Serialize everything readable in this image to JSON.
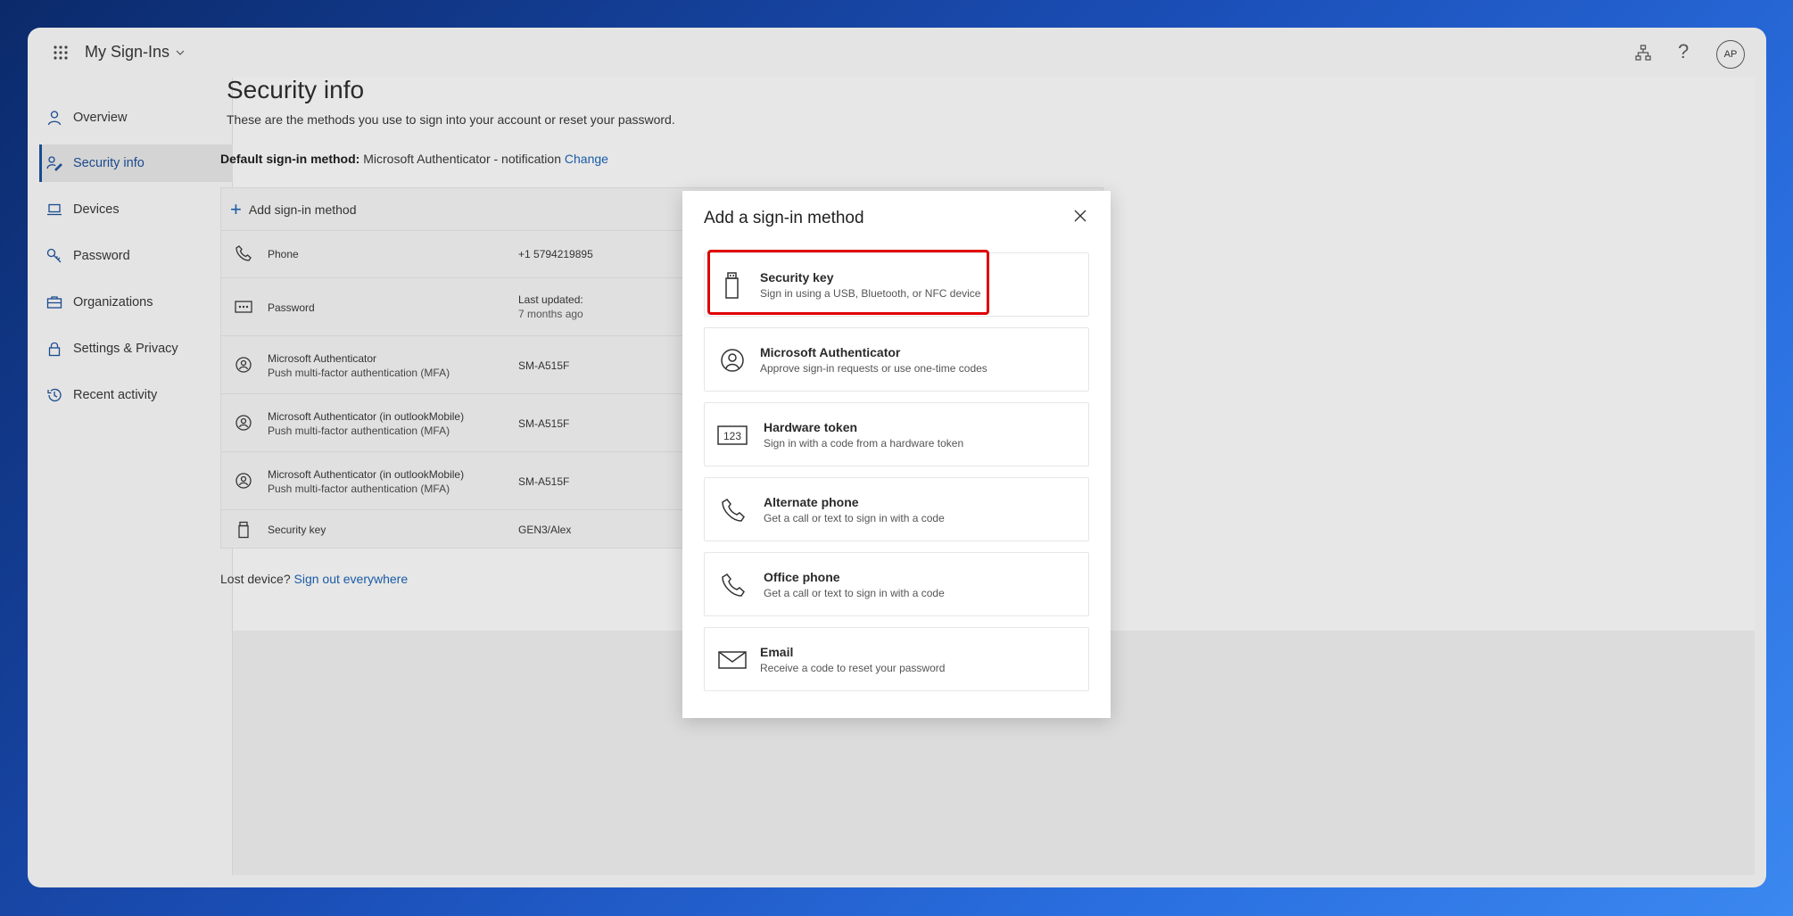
{
  "app": {
    "title": "My Sign-Ins",
    "avatar_initials": "AP"
  },
  "nav": {
    "items": [
      {
        "label": "Overview",
        "icon": "person-icon"
      },
      {
        "label": "Security info",
        "icon": "security-info-icon"
      },
      {
        "label": "Devices",
        "icon": "laptop-icon"
      },
      {
        "label": "Password",
        "icon": "key-icon"
      },
      {
        "label": "Organizations",
        "icon": "briefcase-icon"
      },
      {
        "label": "Settings & Privacy",
        "icon": "lock-icon"
      },
      {
        "label": "Recent activity",
        "icon": "history-icon"
      }
    ],
    "active": "Security info"
  },
  "page": {
    "title": "Security info",
    "subtitle": "These are the methods you use to sign into your account or reset your password.",
    "default_label": "Default sign-in method:",
    "default_value": "Microsoft Authenticator - notification",
    "change_link": "Change",
    "add_method": "Add sign-in method",
    "lost_device_label": "Lost device?",
    "sign_out_everywhere": "Sign out everywhere"
  },
  "methods": [
    {
      "name": "Phone",
      "detail": "",
      "value": "+1 5794219895",
      "value2": "",
      "icon": "phone-icon"
    },
    {
      "name": "Password",
      "detail": "",
      "value": "Last updated:",
      "value2": "7 months ago",
      "icon": "password-icon"
    },
    {
      "name": "Microsoft Authenticator",
      "detail": "Push multi-factor authentication (MFA)",
      "value": "SM-A515F",
      "value2": "",
      "icon": "authenticator-icon"
    },
    {
      "name": "Microsoft Authenticator (in outlookMobile)",
      "detail": "Push multi-factor authentication (MFA)",
      "value": "SM-A515F",
      "value2": "",
      "icon": "authenticator-icon"
    },
    {
      "name": "Microsoft Authenticator (in outlookMobile)",
      "detail": "Push multi-factor authentication (MFA)",
      "value": "SM-A515F",
      "value2": "",
      "icon": "authenticator-icon"
    },
    {
      "name": "Security key",
      "detail": "",
      "value": "GEN3/Alex",
      "value2": "",
      "icon": "usb-key-icon"
    }
  ],
  "dialog": {
    "title": "Add a sign-in method",
    "options": [
      {
        "name": "Security key",
        "desc": "Sign in using a USB, Bluetooth, or NFC device",
        "icon": "usb-key-icon"
      },
      {
        "name": "Microsoft Authenticator",
        "desc": "Approve sign-in requests or use one-time codes",
        "icon": "authenticator-icon"
      },
      {
        "name": "Hardware token",
        "desc": "Sign in with a code from a hardware token",
        "icon": "hardware-token-icon",
        "icon_text": "123"
      },
      {
        "name": "Alternate phone",
        "desc": "Get a call or text to sign in with a code",
        "icon": "phone-icon"
      },
      {
        "name": "Office phone",
        "desc": "Get a call or text to sign in with a code",
        "icon": "phone-icon"
      },
      {
        "name": "Email",
        "desc": "Receive a code to reset your password",
        "icon": "mail-icon"
      }
    ]
  },
  "colors": {
    "accent": "#1a5ba6",
    "highlight": "#e00000",
    "overlay": "#e4e4e4"
  }
}
